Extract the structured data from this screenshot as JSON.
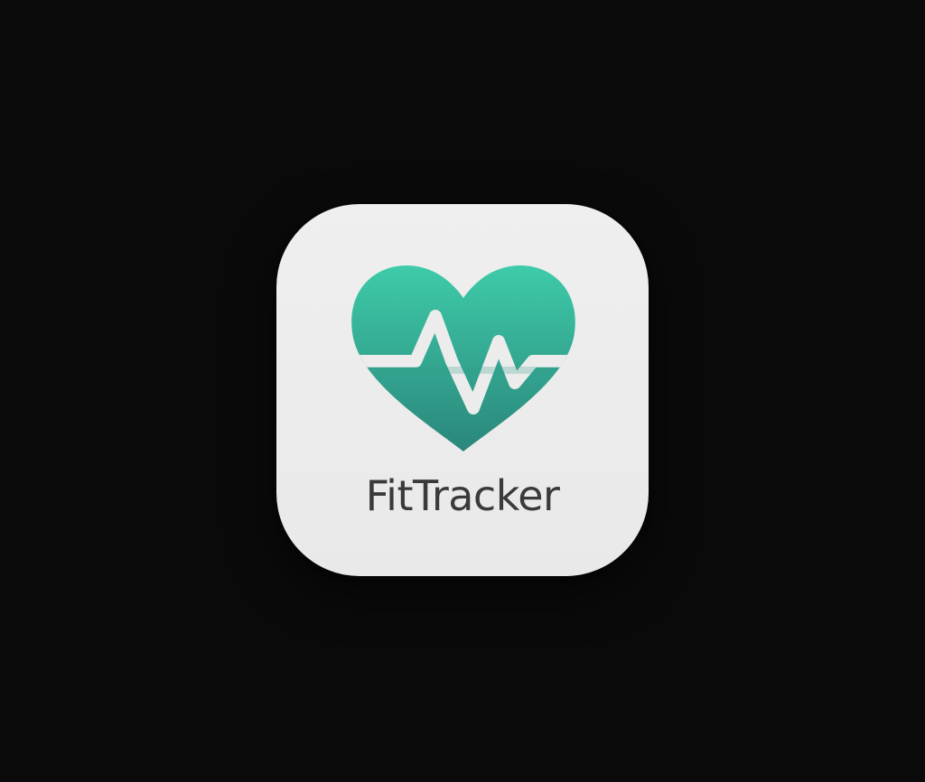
{
  "app": {
    "name": "FitTracker",
    "icon": "heart-pulse-icon"
  },
  "colors": {
    "background": "#0a0a0a",
    "tile": "#ececec",
    "heart_top": "#3cc8a8",
    "heart_bottom": "#2a8a7c",
    "label": "#3a3a3a"
  }
}
